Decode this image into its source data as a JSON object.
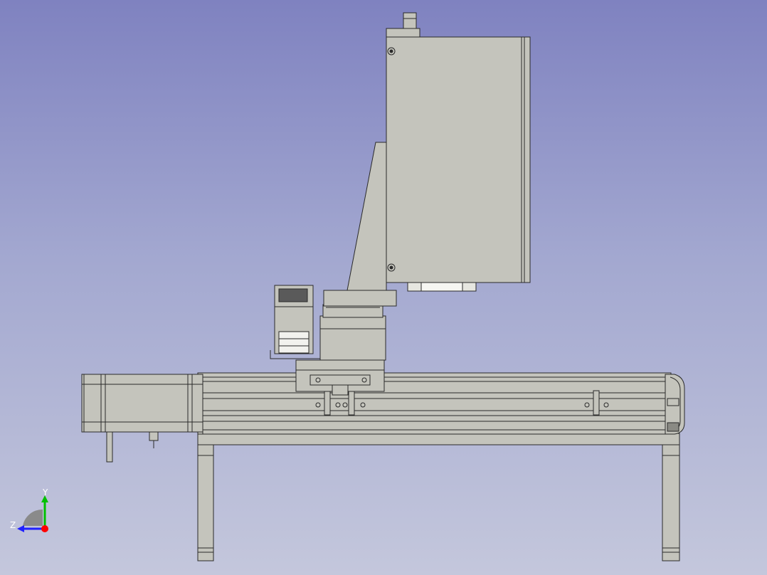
{
  "viewer": {
    "background_top": "#7f82c0",
    "background_bottom": "#c4c7dc"
  },
  "axis_gizmo": {
    "y_label": "Y",
    "z_label": "Z",
    "y_color": "#00c000",
    "z_color": "#2020ff",
    "x_color": "#ff0000"
  },
  "model": {
    "fill_color": "#c4c4bc",
    "edge_color": "#2a2a2a"
  }
}
